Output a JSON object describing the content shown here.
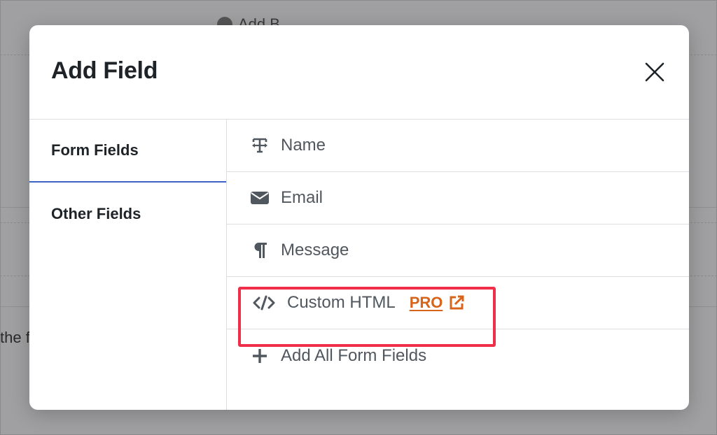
{
  "background": {
    "add_button_label": "Add B",
    "partial_text": "the f"
  },
  "modal": {
    "title": "Add Field",
    "close_icon": "close-icon",
    "tabs": [
      {
        "label": "Form Fields",
        "active": true
      },
      {
        "label": "Other Fields",
        "active": false
      }
    ],
    "fields": [
      {
        "label": "Name",
        "icon": "text-field-icon"
      },
      {
        "label": "Email",
        "icon": "envelope-icon"
      },
      {
        "label": "Message",
        "icon": "paragraph-icon"
      },
      {
        "label": "Custom HTML",
        "icon": "code-icon",
        "badge": "PRO",
        "badge_icon": "external-link-icon",
        "highlighted": true
      },
      {
        "label": "Add All Form Fields",
        "icon": "plus-icon"
      }
    ]
  },
  "colors": {
    "accent_tab": "#3b63c4",
    "pro_badge": "#d8631b",
    "highlight_border": "#ef2f4a",
    "text_dark": "#1d2327",
    "text_muted": "#50575e"
  }
}
